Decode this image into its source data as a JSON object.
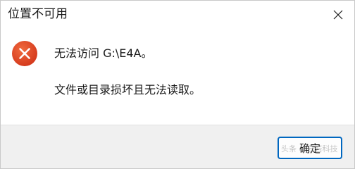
{
  "window": {
    "title": "位置不可用",
    "close_icon": "close-icon"
  },
  "message": {
    "icon": "error-icon",
    "line1": "无法访问 G:\\E4A。",
    "line2": "文件或目录损坏且无法读取。"
  },
  "footer": {
    "ok_label": "确定"
  },
  "watermark": {
    "text": "头条 @云岩科技"
  },
  "colors": {
    "error_red": "#e0401c",
    "accent_blue": "#0067c0",
    "footer_bg": "#f0f0f0"
  }
}
